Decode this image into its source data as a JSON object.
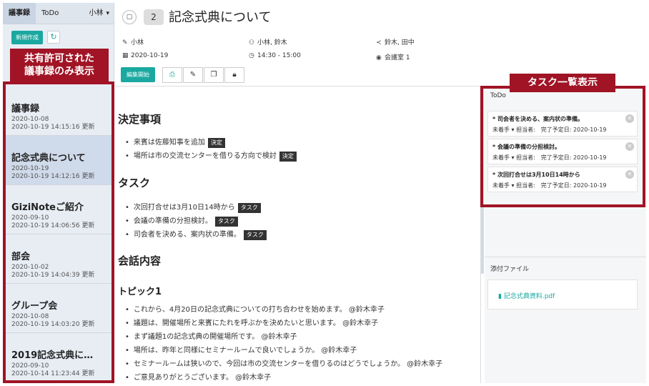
{
  "sidebar": {
    "tabs": [
      {
        "label": "議事録"
      },
      {
        "label": "ToDo"
      },
      {
        "label": "小林"
      }
    ],
    "new_button": "新規作成",
    "items": [
      {
        "title": "議事録",
        "date": "2020-10-08",
        "updated": "2020-10-19 14:15:16 更新"
      },
      {
        "title": "記念式典について",
        "date": "2020-10-19",
        "updated": "2020-10-19 14:12:16 更新"
      },
      {
        "title": "GiziNoteご紹介",
        "date": "2020-09-10",
        "updated": "2020-10-19 14:06:56 更新"
      },
      {
        "title": "部会",
        "date": "2020-10-02",
        "updated": "2020-10-19 14:04:39 更新"
      },
      {
        "title": "グループ会",
        "date": "2020-10-08",
        "updated": "2020-10-19 14:03:20 更新"
      },
      {
        "title": "2019記念式典に…",
        "date": "2020-09-10",
        "updated": "2020-10-14 11:23:44 更新"
      }
    ]
  },
  "callouts": {
    "left_line1": "共有許可された",
    "left_line2": "議事録のみ表示",
    "right": "タスク一覧表示"
  },
  "header": {
    "number": "2",
    "title": "記念式典について",
    "author": "小林",
    "participants": "小林, 鈴木",
    "shared": "鈴木, 田中",
    "date": "2020-10-19",
    "time": "14:30 - 15:00",
    "place": "会議室 1",
    "edit_button": "編集開始"
  },
  "content": {
    "decisions_heading": "決定事項",
    "decisions": [
      {
        "text": "来賓は佐藤知事を追加",
        "tag": "決定"
      },
      {
        "text": "場所は市の交流センターを借りる方向で検討",
        "tag": "決定"
      }
    ],
    "tasks_heading": "タスク",
    "tasks": [
      {
        "text": "次回打合せは3月10日14時から",
        "tag": "タスク"
      },
      {
        "text": "会議の準備の分担検討。",
        "tag": "タスク"
      },
      {
        "text": "司会者を決める、案内状の準備。",
        "tag": "タスク"
      }
    ],
    "talk_heading": "会話内容",
    "topic_heading": "トピック1",
    "talk": [
      "これから、4月20日の記念式典についての打ち合わせを始めます。 @鈴木幸子",
      "議題は、開催場所と来賓にたれを呼ぶかを決めたいと思います。 @鈴木幸子",
      "まず議題1の記念式典の開催場所です。 @鈴木幸子",
      "場所は、昨年と同様にセミナールームで良いでしょうか。 @鈴木幸子",
      "セミナールームは狭いので、今回は市の交流センターを借りるのはどうでしょうか。 @鈴木幸子",
      "ご意見ありがとうございます。 @鈴木幸子"
    ]
  },
  "todo": {
    "heading": "ToDo",
    "items": [
      {
        "title": "* 司会者を決める、案内状の準備。",
        "meta": "未着手 ▾ 担当者:　完了予定日: 2020-10-19"
      },
      {
        "title": "* 会議の準備の分担検討。",
        "meta": "未着手 ▾ 担当者:　完了予定日: 2020-10-19"
      },
      {
        "title": "* 次回打合せは3月10日14時から",
        "meta": "未着手 ▾ 担当者:　完了予定日: 2020-10-19"
      }
    ]
  },
  "attachments": {
    "heading": "添付ファイル",
    "files": [
      "記念式典資料.pdf"
    ]
  }
}
